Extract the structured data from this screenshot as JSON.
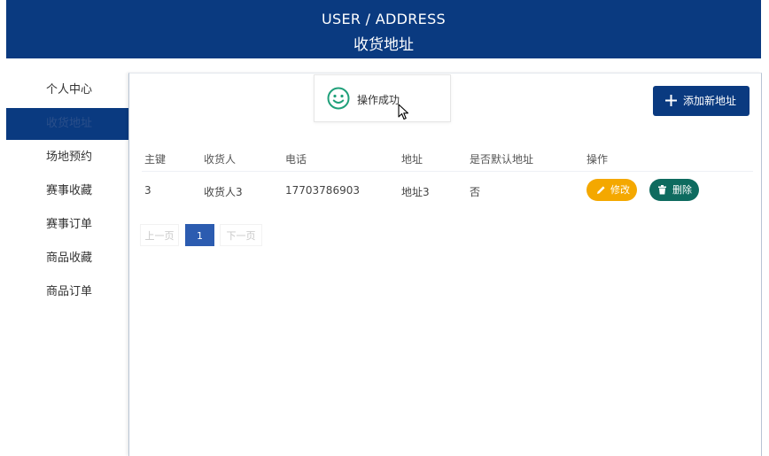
{
  "header": {
    "title_en": "USER / ADDRESS",
    "title_cn": "收货地址"
  },
  "sidebar": {
    "items": [
      {
        "label": "个人中心",
        "active": false
      },
      {
        "label": "收货地址",
        "active": true
      },
      {
        "label": "场地预约",
        "active": false
      },
      {
        "label": "赛事收藏",
        "active": false
      },
      {
        "label": "赛事订单",
        "active": false
      },
      {
        "label": "商品收藏",
        "active": false
      },
      {
        "label": "商品订单",
        "active": false
      }
    ]
  },
  "toast": {
    "message": "操作成功",
    "icon": "smile-icon"
  },
  "toolbar": {
    "add_label": "添加新地址"
  },
  "table": {
    "headers": [
      "主键",
      "收货人",
      "电话",
      "地址",
      "是否默认地址",
      "操作"
    ],
    "rows": [
      {
        "id": "3",
        "receiver": "收货人3",
        "phone": "17703786903",
        "address": "地址3",
        "is_default": "否"
      }
    ],
    "edit_label": "修改",
    "delete_label": "删除"
  },
  "pagination": {
    "prev_label": "上一页",
    "current": "1",
    "next_label": "下一页"
  },
  "colors": {
    "primary": "#0a3a80",
    "edit": "#f4a800",
    "delete": "#0e6b5f",
    "page_active": "#2c5cb0",
    "toast_icon": "#20a07a"
  }
}
